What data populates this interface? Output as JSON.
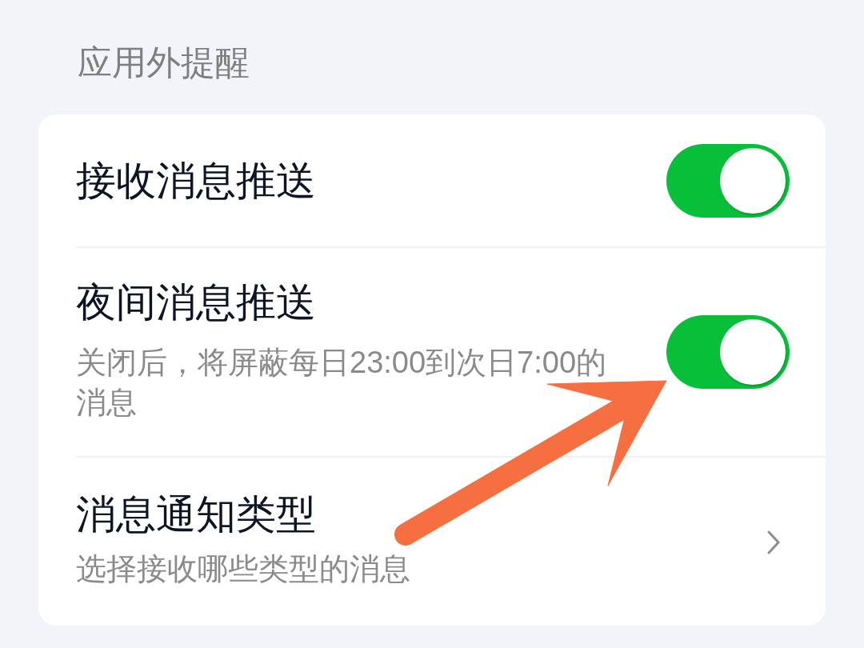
{
  "section_title": "应用外提醒",
  "settings": [
    {
      "kind": "toggle",
      "title": "接收消息推送",
      "on": true
    },
    {
      "kind": "toggle",
      "title": "夜间消息推送",
      "description": "关闭后，将屏蔽每日23:00到次日7:00的消息",
      "on": true
    },
    {
      "kind": "link",
      "title": "消息通知类型",
      "description": "选择接收哪些类型的消息"
    }
  ]
}
